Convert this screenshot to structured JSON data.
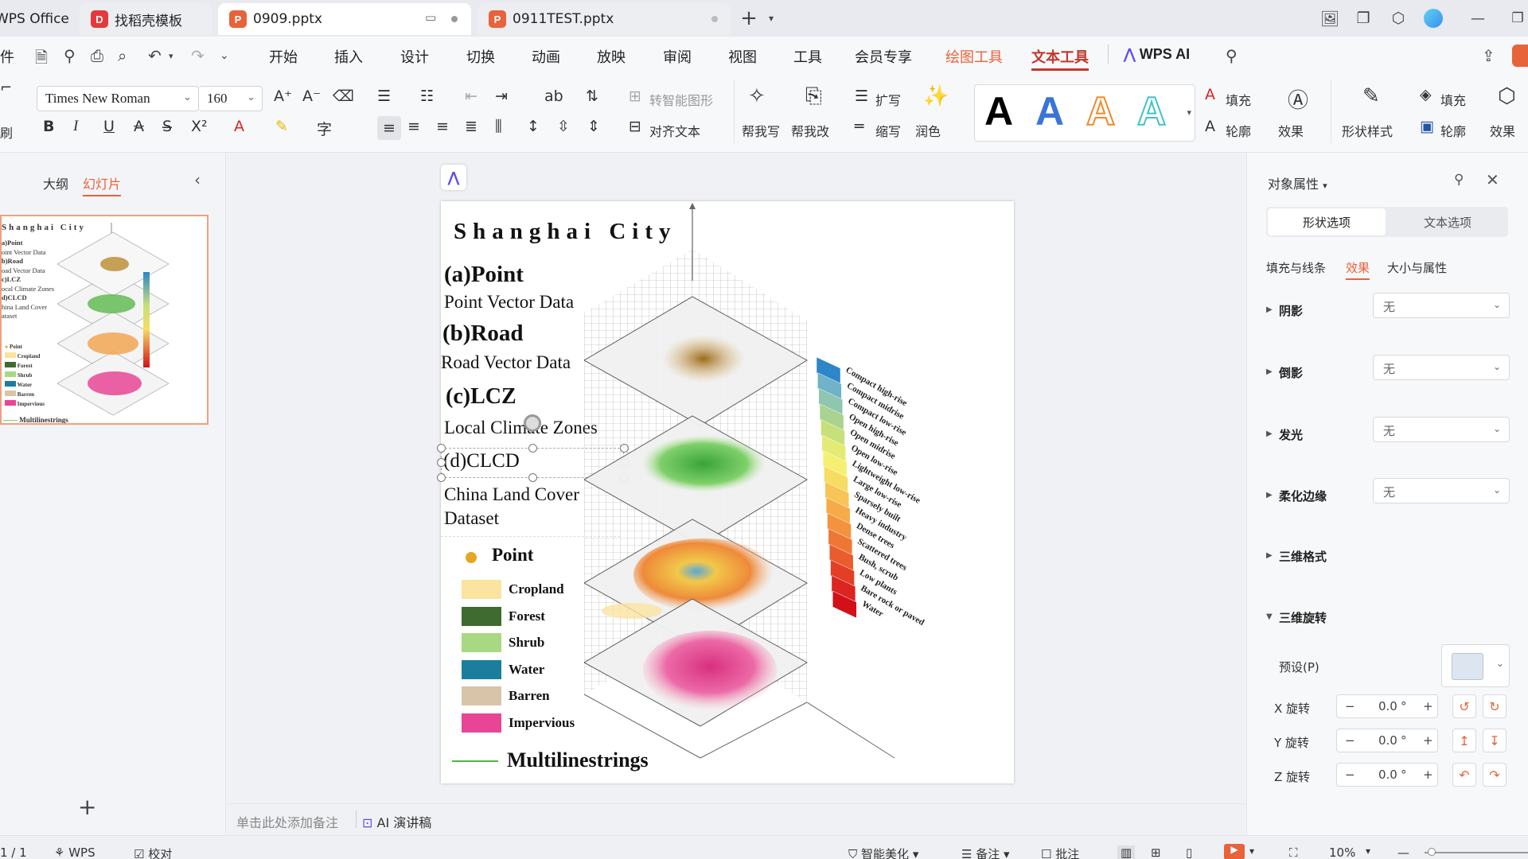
{
  "titlebar": {
    "app_name": "WPS Office",
    "tabs": [
      {
        "label": "找稻壳模板",
        "icon": "docer-icon"
      },
      {
        "label": "0909.pptx",
        "icon": "ppt-file-icon"
      },
      {
        "label": "0911TEST.pptx",
        "icon": "ppt-file-icon"
      }
    ],
    "new_tab": "+"
  },
  "menubar": {
    "file_partial": "件",
    "items": [
      "开始",
      "插入",
      "设计",
      "切换",
      "动画",
      "放映",
      "审阅",
      "视图",
      "工具",
      "会员专享",
      "绘图工具",
      "文本工具",
      "WPS AI"
    ]
  },
  "ribbon": {
    "font_name": "Times New Roman",
    "font_size": "160",
    "convert_shape": "转智能图形",
    "align_text": "对齐文本",
    "help_write": "帮我写",
    "help_edit": "帮我改",
    "expand": "扩写",
    "shrink": "缩写",
    "polish": "润色",
    "fill": "填充",
    "outline": "轮廓",
    "effect": "效果",
    "shape_style": "形状样式",
    "fill2": "填充",
    "outline2": "轮廓",
    "effect2": "效果",
    "format_painter_partial": "刷",
    "text_style_letters": [
      "A",
      "A",
      "A",
      "A"
    ],
    "colors": {
      "accent": "#e8623a",
      "text_tool_red": "#c0392b"
    }
  },
  "leftpanel": {
    "tab_outline": "大纲",
    "tab_slides": "幻灯片",
    "add_slide": "+",
    "thumb": {
      "title": "Shanghai City",
      "lines": [
        "a)Point",
        "oint Vector Data",
        "b)Road",
        "oad Vector Data",
        "c)LCZ",
        "ocal Climate Zones",
        "d)CLCD",
        "hina Land Cover",
        "ataset"
      ],
      "legend": [
        "Point",
        "Cropland",
        "Forest",
        "Shrub",
        "Water",
        "Barren",
        "Impervious"
      ],
      "footer": "Multilinestrings"
    }
  },
  "slide": {
    "title": "Shanghai City",
    "a_head": "(a)Point",
    "a_sub": "Point Vector Data",
    "b_head": "(b)Road",
    "b_sub": "Road Vector Data",
    "c_head": "(c)LCZ",
    "c_sub": "Local Climate Zones",
    "d_head": "(d)CLCD",
    "d_sub1": "China Land Cover",
    "d_sub2": "Dataset",
    "legend_point": "Point",
    "legend": [
      {
        "label": "Cropland",
        "color": "#fbe3a0"
      },
      {
        "label": "Forest",
        "color": "#3f6b30"
      },
      {
        "label": "Shrub",
        "color": "#a9d882"
      },
      {
        "label": "Water",
        "color": "#1a7f9c"
      },
      {
        "label": "Barren",
        "color": "#d8c4a8"
      },
      {
        "label": "Impervious",
        "color": "#e84595"
      }
    ],
    "legend_line": "Multilinestrings",
    "lcz_classes": [
      {
        "label": "Compact high-rise",
        "color": "#2c86c8"
      },
      {
        "label": "Compact midrise",
        "color": "#6fb3c8"
      },
      {
        "label": "Compact low-rise",
        "color": "#8ec6b0"
      },
      {
        "label": "Open high-rise",
        "color": "#a9d38e"
      },
      {
        "label": "Open midrise",
        "color": "#c7e07a"
      },
      {
        "label": "Open low-rise",
        "color": "#e3eb75"
      },
      {
        "label": "Lightweight low-rise",
        "color": "#f6f070"
      },
      {
        "label": "Large low-rise",
        "color": "#f7dc62"
      },
      {
        "label": "Sparsely built",
        "color": "#f7c455"
      },
      {
        "label": "Heavy industry",
        "color": "#f6ab48"
      },
      {
        "label": "Dense trees",
        "color": "#f4923e"
      },
      {
        "label": "Scattered trees",
        "color": "#ef7735"
      },
      {
        "label": "Bush, scrub",
        "color": "#ea5b2d"
      },
      {
        "label": "Low plants",
        "color": "#e33e26"
      },
      {
        "label": "Bare rock or paved",
        "color": "#dc2420"
      },
      {
        "label": "Water",
        "color": "#d31018"
      }
    ]
  },
  "rightpanel": {
    "title": "对象属性",
    "tab_shape": "形状选项",
    "tab_text": "文本选项",
    "subtabs": [
      "填充与线条",
      "效果",
      "大小与属性"
    ],
    "rows": [
      {
        "label": "阴影",
        "value": "无"
      },
      {
        "label": "倒影",
        "value": "无"
      },
      {
        "label": "发光",
        "value": "无"
      },
      {
        "label": "柔化边缘",
        "value": "无"
      }
    ],
    "format3d": "三维格式",
    "rotate3d": "三维旋转",
    "preset": "预设(P)",
    "rotations": [
      {
        "label": "X 旋转",
        "value": "0.0",
        "unit": "°"
      },
      {
        "label": "Y 旋转",
        "value": "0.0",
        "unit": "°"
      },
      {
        "label": "Z 旋转",
        "value": "0.0",
        "unit": "°"
      }
    ]
  },
  "notes": {
    "placeholder": "单击此处添加备注",
    "ai_speech": "AI 演讲稿"
  },
  "statusbar": {
    "page": "1 / 1",
    "wps": "WPS",
    "proof": "校对",
    "beautify": "智能美化",
    "notes": "备注",
    "comments": "批注",
    "zoom": "10%"
  }
}
